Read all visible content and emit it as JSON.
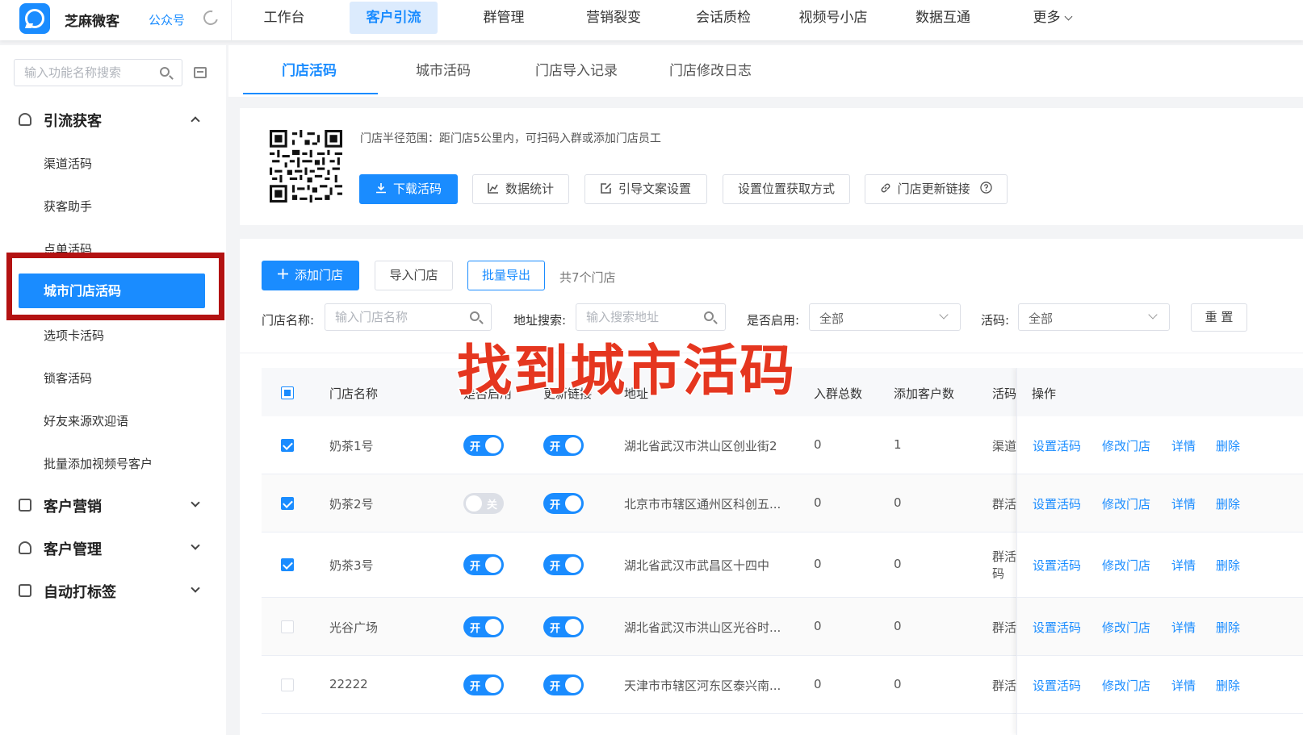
{
  "top": {
    "brand": "芝麻微客",
    "sub": "公众号",
    "nav": [
      "工作台",
      "客户引流",
      "群管理",
      "营销裂变",
      "会话质检",
      "视频号小店",
      "数据互通",
      "更多"
    ],
    "active_nav": 1
  },
  "sidebar": {
    "search_placeholder": "输入功能名称搜索",
    "group1": "引流获客",
    "items": [
      "渠道活码",
      "获客助手",
      "点单活码",
      "城市门店活码",
      "选项卡活码",
      "锁客活码",
      "好友来源欢迎语",
      "批量添加视频号客户"
    ],
    "group2": "客户营销",
    "group3": "客户管理",
    "group4": "自动打标签"
  },
  "tabs": [
    "门店活码",
    "城市活码",
    "门店导入记录",
    "门店修改日志"
  ],
  "info": {
    "radius": "门店半径范围：距门店5公里内，可扫码入群或添加门店员工",
    "buttons": [
      "下载活码",
      "数据统计",
      "引导文案设置",
      "设置位置获取方式",
      "门店更新链接"
    ]
  },
  "list": {
    "add": "添加门店",
    "import": "导入门店",
    "export": "批量导出",
    "count": "共7个门店",
    "filters": {
      "name_label": "门店名称:",
      "name_placeholder": "输入门店名称",
      "addr_label": "地址搜索:",
      "addr_placeholder": "输入搜索地址",
      "enabled_label": "是否启用:",
      "enabled_value": "全部",
      "code_label": "活码:",
      "code_value": "全部",
      "reset": "重 置"
    }
  },
  "overlay": "找到城市活码",
  "table": {
    "headers": [
      "门店名称",
      "是否启用",
      "更新链接",
      "地址",
      "入群总数",
      "添加客户数",
      "活码",
      "操作"
    ],
    "actions": [
      "设置活码",
      "修改门店",
      "详情",
      "删除"
    ],
    "switch_on": "开",
    "switch_off": "关",
    "rows": [
      {
        "name": "奶茶1号",
        "addr": "湖北省武汉市洪山区创业街2",
        "join": "0",
        "add": "1",
        "code": "渠道"
      },
      {
        "name": "奶茶2号",
        "addr": "北京市市辖区通州区科创五...",
        "join": "0",
        "add": "0",
        "code": "群活"
      },
      {
        "name": "奶茶3号",
        "addr": "湖北省武汉市武昌区十四中",
        "join": "0",
        "add": "0",
        "code": "群活码"
      },
      {
        "name": "光谷广场",
        "addr": "湖北省武汉市洪山区光谷时...",
        "join": "0",
        "add": "0",
        "code": "群活"
      },
      {
        "name": "22222",
        "addr": "天津市市辖区河东区泰兴南...",
        "join": "0",
        "add": "0",
        "code": "群活"
      }
    ]
  },
  "colors": {
    "accent": "#1a8cff",
    "highlight": "#b31212",
    "overlay": "#e5361f"
  }
}
